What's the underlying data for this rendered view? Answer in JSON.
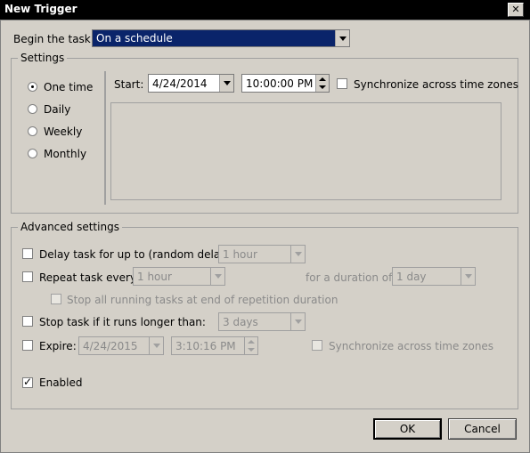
{
  "window": {
    "title": "New Trigger",
    "close_label": "✕"
  },
  "begin": {
    "label": "Begin the task:",
    "value": "On a schedule"
  },
  "settings": {
    "title": "Settings",
    "radios": [
      {
        "label": "One time",
        "selected": true
      },
      {
        "label": "Daily",
        "selected": false
      },
      {
        "label": "Weekly",
        "selected": false
      },
      {
        "label": "Monthly",
        "selected": false
      }
    ],
    "start_label": "Start:",
    "start_date": "4/24/2014",
    "start_time": "10:00:00 PM",
    "sync_label": "Synchronize across time zones"
  },
  "advanced": {
    "title": "Advanced settings",
    "delay_label": "Delay task for up to (random delay):",
    "delay_value": "1 hour",
    "repeat_label": "Repeat task every:",
    "repeat_value": "1 hour",
    "duration_label": "for a duration of:",
    "duration_value": "1 day",
    "stop_all_label": "Stop all running tasks at end of repetition duration",
    "stop_if_label": "Stop task if it runs longer than:",
    "stop_if_value": "3 days",
    "expire_label": "Expire:",
    "expire_date": "4/24/2015",
    "expire_time": "3:10:16 PM",
    "expire_sync_label": "Synchronize across time zones",
    "enabled_label": "Enabled"
  },
  "buttons": {
    "ok": "OK",
    "cancel": "Cancel"
  }
}
